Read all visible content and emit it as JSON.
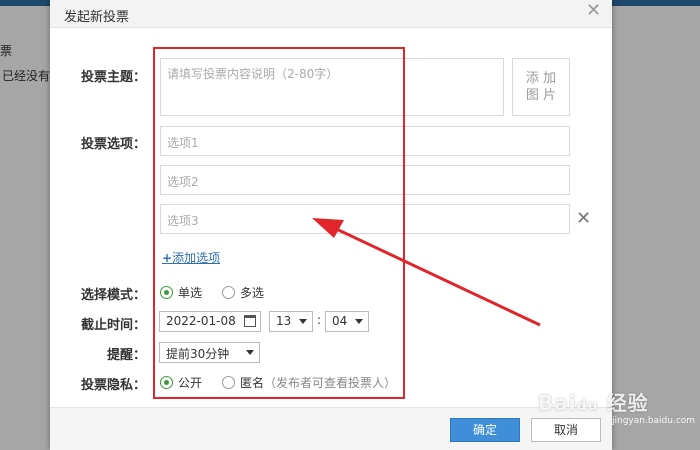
{
  "background": {
    "text1": "票",
    "text2": "已经没有"
  },
  "dialog": {
    "title": "发起新投票",
    "subject": {
      "label": "投票主题：",
      "placeholder": "请填写投票内容说明（2-80字）",
      "image_button": "添 加\n图 片"
    },
    "options": {
      "label": "投票选项：",
      "items": [
        "选项1",
        "选项2",
        "选项3"
      ],
      "add_label": "添加选项"
    },
    "mode": {
      "label": "选择模式：",
      "single": "单选",
      "multiple": "多选",
      "selected": "single"
    },
    "deadline": {
      "label": "截止时间：",
      "date": "2022-01-08",
      "hour": "13",
      "minute": "04"
    },
    "remind": {
      "label": "提醒：",
      "value": "提前30分钟"
    },
    "privacy": {
      "label": "投票隐私：",
      "public": "公开",
      "anonymous": "匿名",
      "anonymous_note": "（发布者可查看投票人）",
      "selected": "public"
    },
    "footer": {
      "ok": "确定",
      "cancel": "取消"
    }
  },
  "watermark": {
    "brand": "Bai du 经验",
    "url": "jingyan.baidu.com"
  },
  "colors": {
    "accent": "#3e8ed8",
    "highlight": "#e0262a",
    "radio_checked": "#3c9a3c"
  }
}
